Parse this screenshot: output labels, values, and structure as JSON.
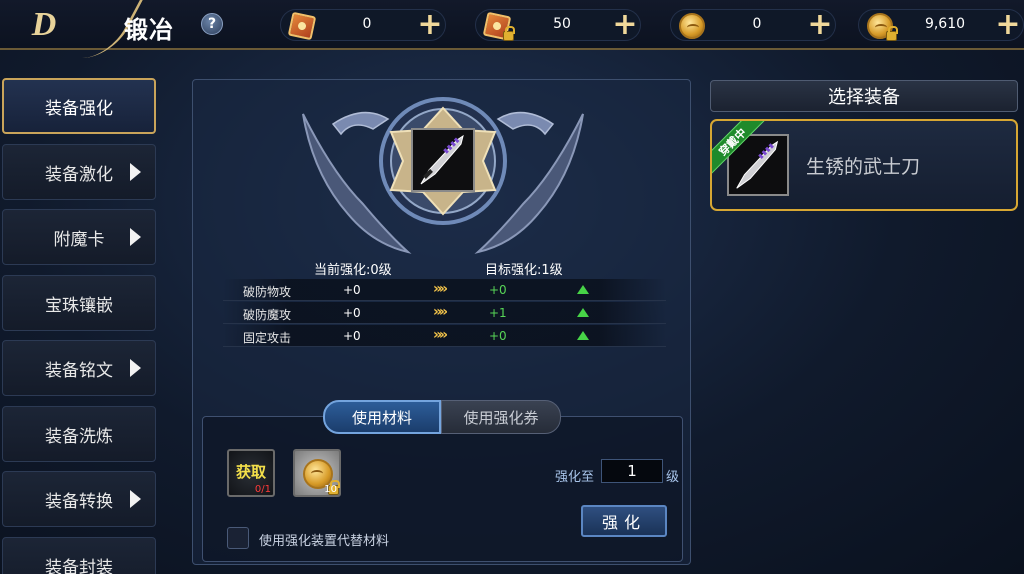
{
  "header": {
    "back_logo": "D",
    "title": "锻冶",
    "help": "?",
    "resources": [
      {
        "icon": "enhance-scroll-icon",
        "value": "0",
        "plus": "+"
      },
      {
        "icon": "locked-enhance-scroll-icon",
        "value": "50",
        "plus": "+"
      },
      {
        "icon": "gold-coin-icon",
        "value": "0",
        "plus": "+"
      },
      {
        "icon": "locked-gold-coin-icon",
        "value": "9,610",
        "plus": "+"
      }
    ]
  },
  "sidebar": {
    "items": [
      {
        "label": "装备强化",
        "active": true,
        "arrow": false
      },
      {
        "label": "装备激化",
        "active": false,
        "arrow": true
      },
      {
        "label": "附魔卡",
        "active": false,
        "arrow": true
      },
      {
        "label": "宝珠镶嵌",
        "active": false,
        "arrow": false
      },
      {
        "label": "装备铭文",
        "active": false,
        "arrow": true
      },
      {
        "label": "装备洗炼",
        "active": false,
        "arrow": false
      },
      {
        "label": "装备转换",
        "active": false,
        "arrow": true
      },
      {
        "label": "装备封装",
        "active": false,
        "arrow": false
      }
    ]
  },
  "enhance": {
    "current_label": "当前强化:0级",
    "target_label": "目标强化:1级",
    "stats": [
      {
        "name": "破防物攻",
        "current": "+0",
        "target": "+0"
      },
      {
        "name": "破防魔攻",
        "current": "+0",
        "target": "+1"
      },
      {
        "name": "固定攻击",
        "current": "+0",
        "target": "+0"
      }
    ],
    "arrow_glyph": "»"
  },
  "materials": {
    "tabs": [
      "使用材料",
      "使用强化券"
    ],
    "active_tab": 0,
    "get_slot": {
      "label": "获取",
      "count": "0/1"
    },
    "coin_slot": {
      "count": "10"
    },
    "level_label": "强化至",
    "level_value": "1",
    "level_unit": "级",
    "enhance_button": "强化",
    "checkbox_label": "使用强化装置代替材料",
    "checkbox_checked": false
  },
  "right_panel": {
    "title": "选择装备",
    "equipment": {
      "badge": "穿戴中",
      "name": "生锈的武士刀"
    }
  },
  "colors": {
    "accent_gold": "#d7a733",
    "stat_up_green": "#47d447",
    "warning_red": "#ff3a3a"
  }
}
